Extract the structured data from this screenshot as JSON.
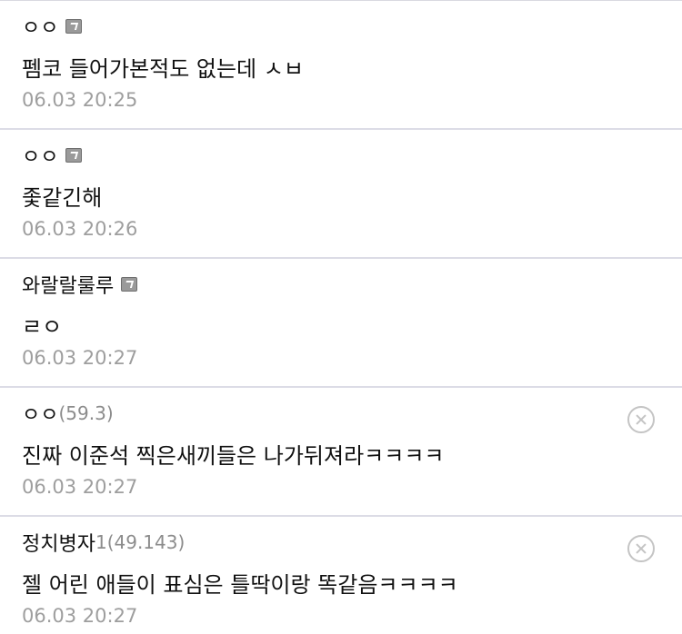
{
  "comments": [
    {
      "nickname": "ㅇㅇ",
      "ip": "",
      "fixed_icon": true,
      "body": "펨코 들어가본적도 없는데 ㅅㅂ",
      "date": "06.03 20:25",
      "deletable": false
    },
    {
      "nickname": "ㅇㅇ",
      "ip": "",
      "fixed_icon": true,
      "body": "좇같긴해",
      "date": "06.03 20:26",
      "deletable": false
    },
    {
      "nickname": "와랄랄룰루",
      "ip": "",
      "fixed_icon": true,
      "body": "ㄹㅇ",
      "date": "06.03 20:27",
      "deletable": false
    },
    {
      "nickname": "ㅇㅇ",
      "ip": "(59.3)",
      "fixed_icon": false,
      "body": "진짜 이준석 찍은새끼들은 나가뒤져라ㅋㅋㅋㅋ",
      "date": "06.03 20:27",
      "deletable": true
    },
    {
      "nickname": "정치병자",
      "ip": "1(49.143)",
      "fixed_icon": false,
      "body": "젤 어린 애들이 표심은 틀딱이랑 똑같음ㅋㅋㅋㅋ",
      "date": "06.03 20:27",
      "deletable": true
    }
  ],
  "icons": {
    "fixed": "fixed-nick-icon",
    "delete": "delete-circle-x-icon"
  },
  "colors": {
    "text": "#111111",
    "meta": "#9e9e9e",
    "divider": "#dcdce6",
    "delete": "#c4c4c4"
  }
}
